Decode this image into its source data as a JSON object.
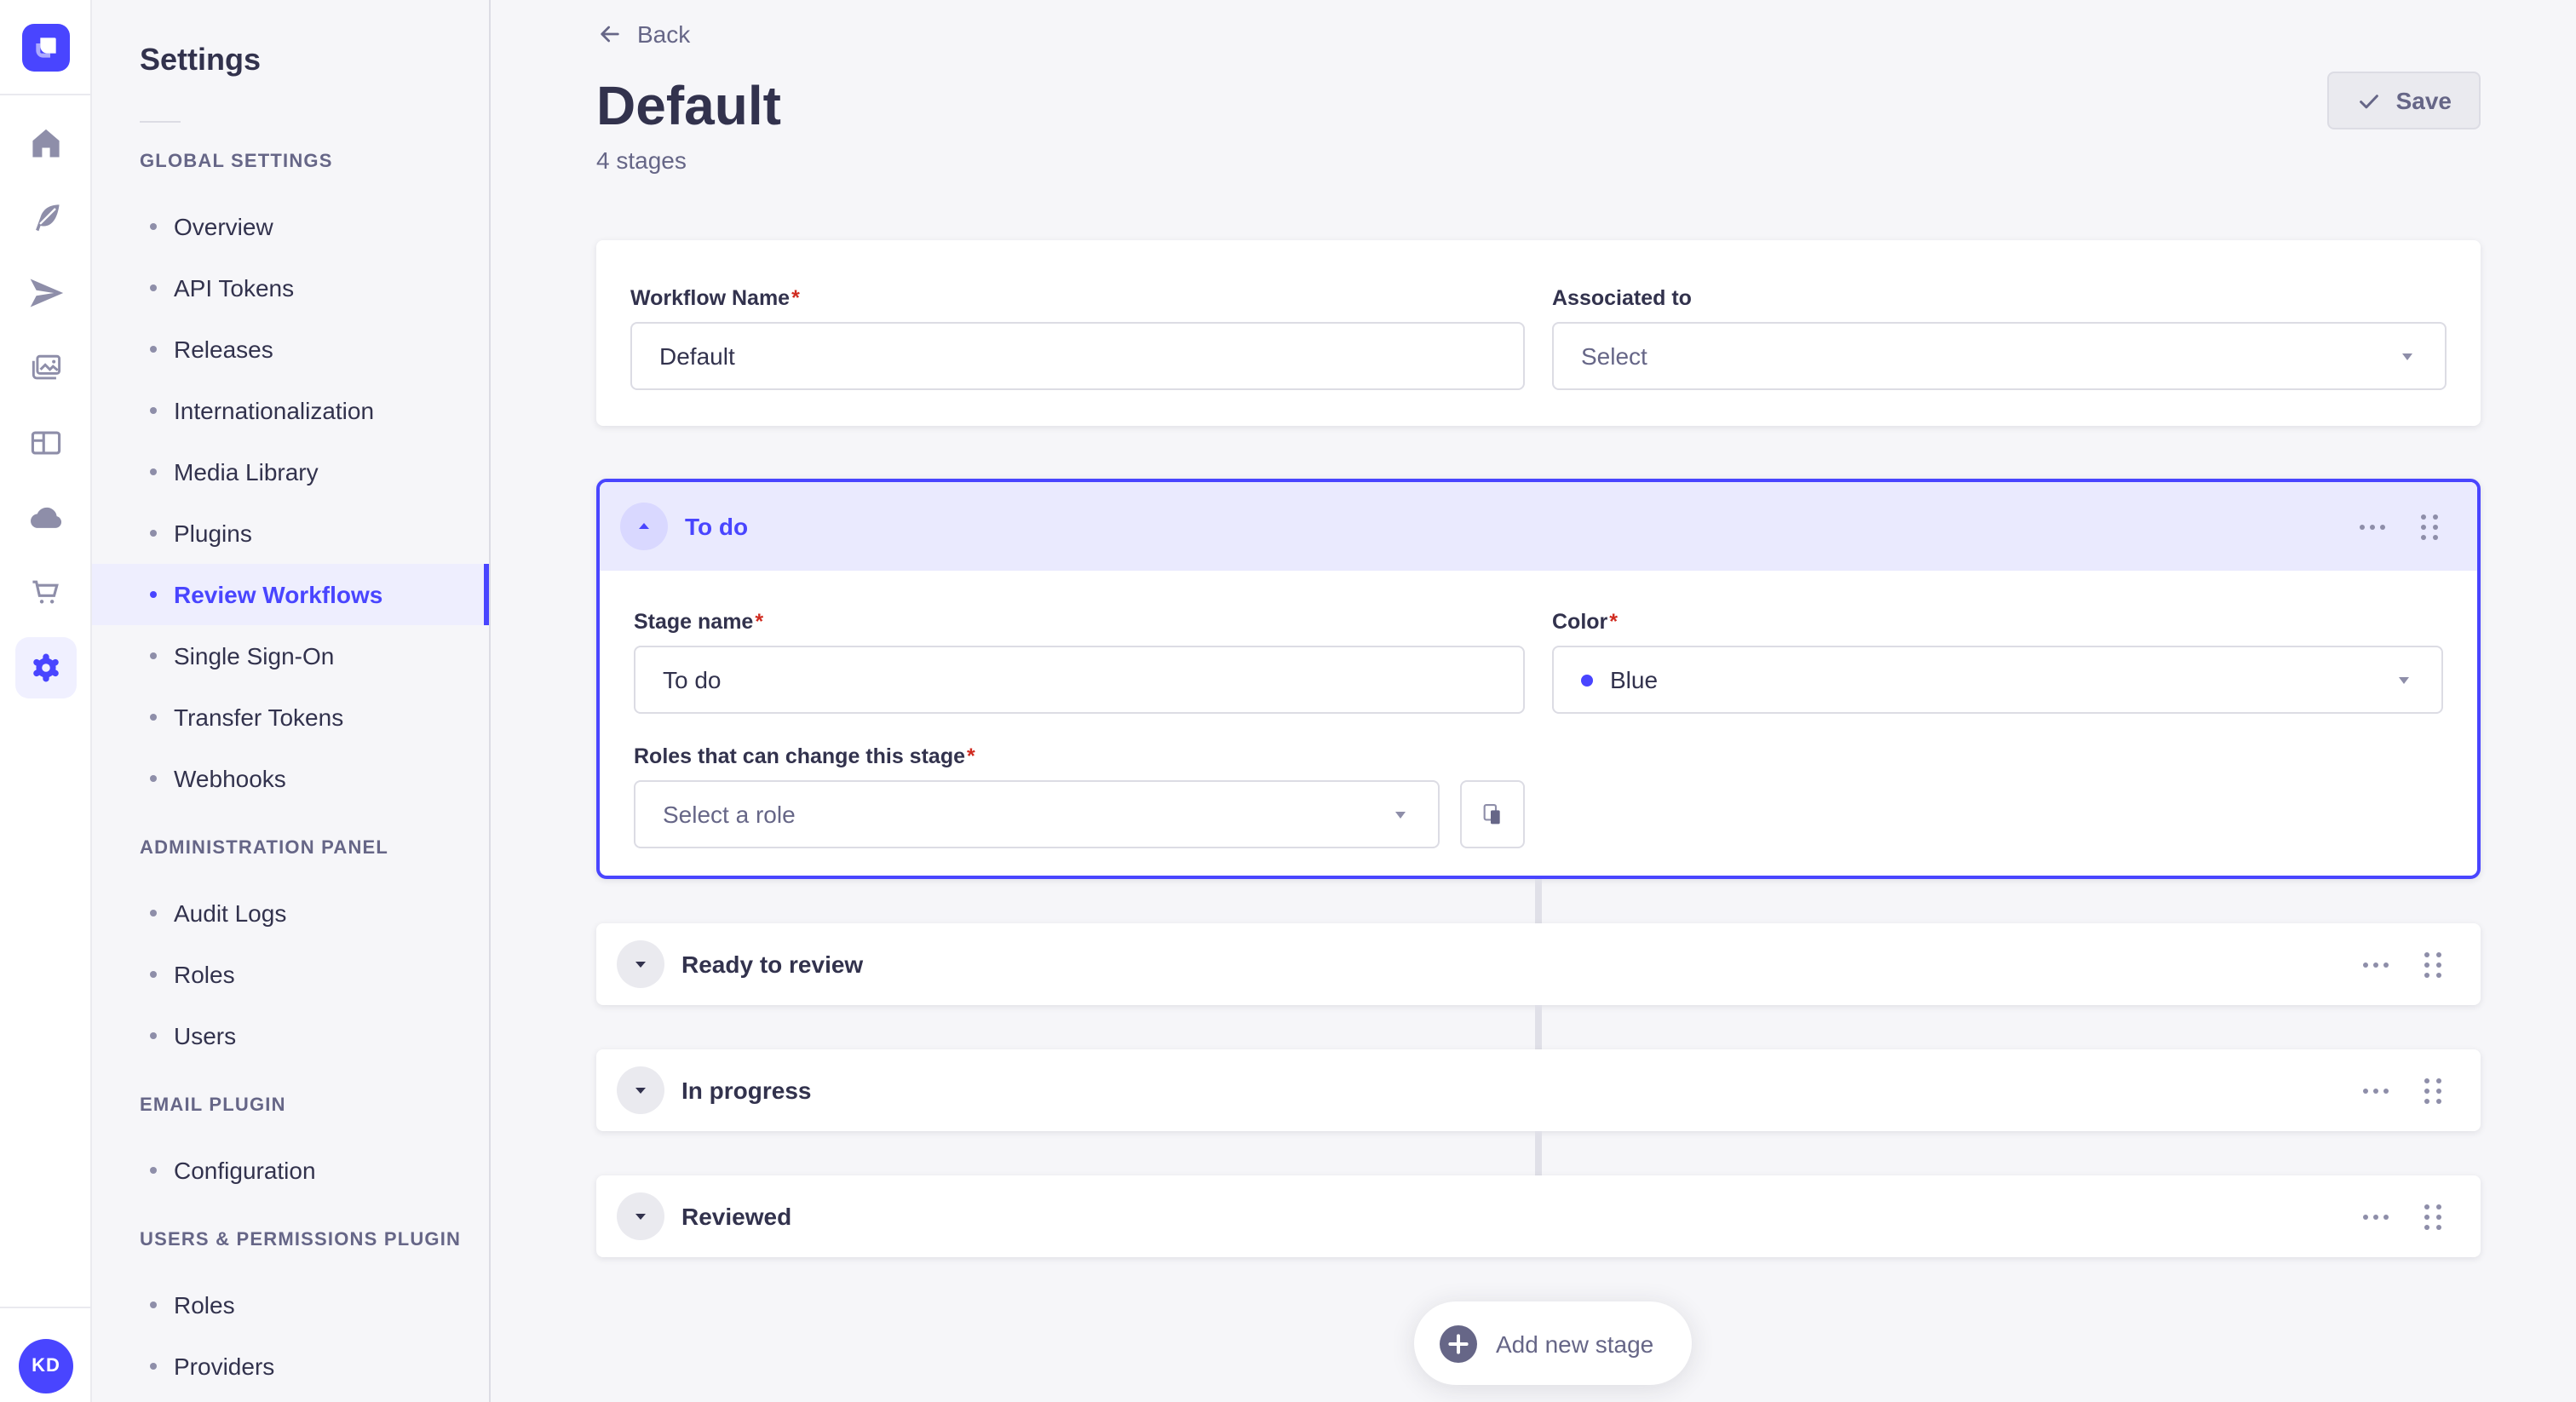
{
  "colors": {
    "primary": "#4945ff",
    "primary_light": "#eaeafe",
    "primary_circle": "#d9d8ff",
    "neutral_bg": "#f6f6f9",
    "border": "#dcdce4",
    "text_dark": "#32324d",
    "text_gray": "#666687",
    "icon_gray": "#8e8ea9",
    "required_red": "#d02b20",
    "stage_color_dot": "#4945ff"
  },
  "icons": {
    "rail": [
      "strapi-logo",
      "home-icon",
      "content-manager-icon",
      "releases-icon",
      "media-library-icon",
      "content-type-builder-icon",
      "deploy-icon",
      "marketplace-icon",
      "settings-icon"
    ],
    "misc": [
      "back-arrow-icon",
      "check-icon",
      "chevron-down-icon",
      "caret-up-icon",
      "caret-down-icon",
      "more-dots-icon",
      "drag-handle-icon",
      "copy-icon",
      "plus-icon",
      "help-icon"
    ]
  },
  "rail": {
    "avatar_initials": "KD"
  },
  "settings_nav": {
    "title": "Settings",
    "sections": [
      {
        "label": "GLOBAL SETTINGS",
        "items": [
          {
            "label": "Overview"
          },
          {
            "label": "API Tokens"
          },
          {
            "label": "Releases"
          },
          {
            "label": "Internationalization"
          },
          {
            "label": "Media Library"
          },
          {
            "label": "Plugins"
          },
          {
            "label": "Review Workflows",
            "active": true
          },
          {
            "label": "Single Sign-On"
          },
          {
            "label": "Transfer Tokens"
          },
          {
            "label": "Webhooks"
          }
        ]
      },
      {
        "label": "ADMINISTRATION PANEL",
        "items": [
          {
            "label": "Audit Logs"
          },
          {
            "label": "Roles"
          },
          {
            "label": "Users"
          }
        ]
      },
      {
        "label": "EMAIL PLUGIN",
        "items": [
          {
            "label": "Configuration"
          }
        ]
      },
      {
        "label": "USERS & PERMISSIONS PLUGIN",
        "items": [
          {
            "label": "Roles"
          },
          {
            "label": "Providers"
          }
        ]
      }
    ]
  },
  "header": {
    "back_label": "Back",
    "title": "Default",
    "subtitle": "4 stages",
    "save_label": "Save"
  },
  "workflow_form": {
    "name_label": "Workflow Name",
    "name_value": "Default",
    "required_mark": "*",
    "associated_label": "Associated to",
    "associated_placeholder": "Select"
  },
  "expanded_stage": {
    "title": "To do",
    "stage_name_label": "Stage name",
    "stage_name_value": "To do",
    "color_label": "Color",
    "color_value": "Blue",
    "roles_label": "Roles that can change this stage",
    "roles_placeholder": "Select a role"
  },
  "collapsed_stages": [
    {
      "title": "Ready to review"
    },
    {
      "title": "In progress"
    },
    {
      "title": "Reviewed"
    }
  ],
  "footer": {
    "add_stage_label": "Add new stage"
  }
}
